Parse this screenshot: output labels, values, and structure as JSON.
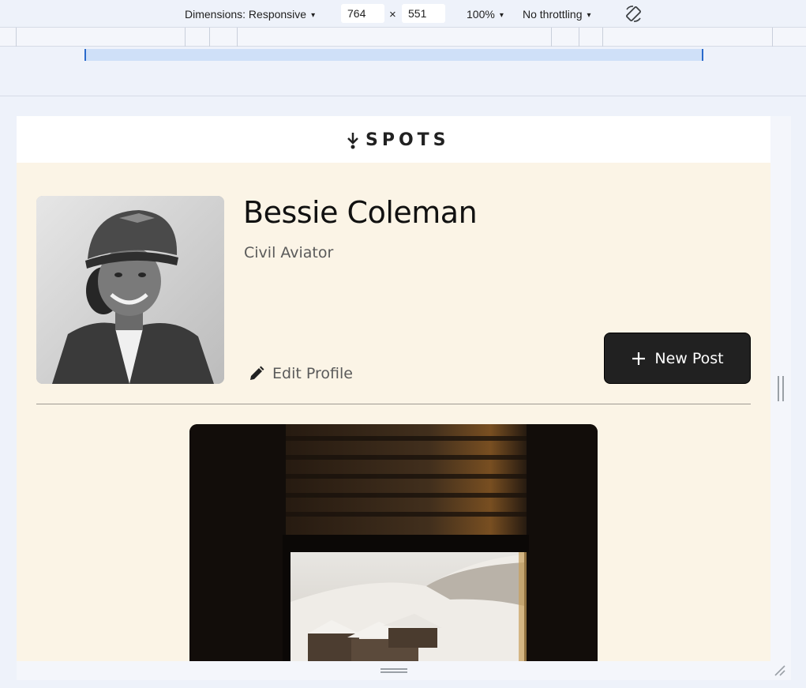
{
  "devtools": {
    "dimensions_label": "Dimensions: Responsive",
    "width_value": "764",
    "height_value": "551",
    "times_symbol": "×",
    "zoom_label": "100%",
    "throttle_label": "No throttling",
    "caret": "▾"
  },
  "site": {
    "logo_text": "SPOTS"
  },
  "profile": {
    "name": "Bessie Coleman",
    "title": "Civil Aviator",
    "edit_label": "Edit Profile",
    "new_post_label": "New Post",
    "plus_symbol": "+"
  },
  "colors": {
    "page_background": "#fbf4e6",
    "button_dark": "#212121",
    "text_muted": "#5a5a5a"
  },
  "icons": {
    "edit": "pencil-icon",
    "new_post": "plus-icon",
    "rotate": "rotate-icon",
    "logo": "spots-logo-icon"
  }
}
